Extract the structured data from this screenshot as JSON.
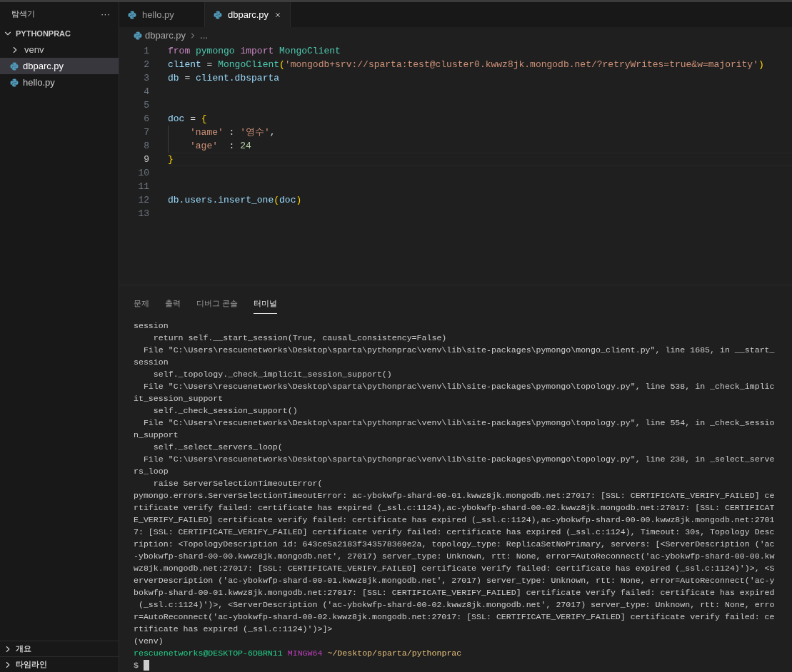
{
  "explorer": {
    "title": "탐색기",
    "more": "···",
    "root": {
      "label": "PYTHONPRAC",
      "expanded": true,
      "children": [
        {
          "label": "venv",
          "kind": "folder",
          "expanded": false,
          "selected": false
        },
        {
          "label": "dbparc.py",
          "kind": "file",
          "selected": true
        },
        {
          "label": "hello.py",
          "kind": "file",
          "selected": false
        }
      ]
    },
    "sections": [
      {
        "label": "개요",
        "expanded": false
      },
      {
        "label": "타임라인",
        "expanded": false
      }
    ]
  },
  "tabs": [
    {
      "label": "hello.py",
      "selected": false
    },
    {
      "label": "dbparc.py",
      "selected": true
    }
  ],
  "breadcrumb": {
    "file": "dbparc.py",
    "rest": "..."
  },
  "editor": {
    "lines": [
      {
        "number": "1",
        "current": false,
        "indented": false,
        "tokens": [
          {
            "text": "from ",
            "kind": "keyword"
          },
          {
            "text": "pymongo ",
            "kind": "module"
          },
          {
            "text": "import ",
            "kind": "keyword"
          },
          {
            "text": "MongoClient",
            "kind": "class"
          }
        ]
      },
      {
        "number": "2",
        "current": false,
        "indented": false,
        "tokens": [
          {
            "text": "client",
            "kind": "variable"
          },
          {
            "text": " = ",
            "kind": "plain"
          },
          {
            "text": "MongoClient",
            "kind": "class"
          },
          {
            "text": "(",
            "kind": "bracket"
          },
          {
            "text": "'mongodb+srv://sparta:test@cluster0.kwwz8jk.mongodb.net/?retryWrites=true&w=majority'",
            "kind": "string"
          },
          {
            "text": ")",
            "kind": "bracket"
          }
        ]
      },
      {
        "number": "3",
        "current": false,
        "indented": false,
        "tokens": [
          {
            "text": "db",
            "kind": "variable"
          },
          {
            "text": " = ",
            "kind": "plain"
          },
          {
            "text": "client.dbsparta",
            "kind": "variable"
          }
        ]
      },
      {
        "number": "4",
        "current": false,
        "indented": false
      },
      {
        "number": "5",
        "current": false,
        "indented": false
      },
      {
        "number": "6",
        "current": false,
        "indented": false,
        "tokens": [
          {
            "text": "doc",
            "kind": "variable"
          },
          {
            "text": " = ",
            "kind": "plain"
          },
          {
            "text": "{",
            "kind": "bracket"
          }
        ]
      },
      {
        "number": "7",
        "current": false,
        "indented": true,
        "tokens": [
          {
            "text": "'name'",
            "kind": "string"
          },
          {
            "text": " : ",
            "kind": "plain"
          },
          {
            "text": "'영수'",
            "kind": "string"
          },
          {
            "text": ",",
            "kind": "plain"
          }
        ]
      },
      {
        "number": "8",
        "current": false,
        "indented": true,
        "tokens": [
          {
            "text": "'age'",
            "kind": "string"
          },
          {
            "text": "  : ",
            "kind": "plain"
          },
          {
            "text": "24",
            "kind": "number"
          }
        ]
      },
      {
        "number": "9",
        "current": true,
        "indented": false,
        "tokens": [
          {
            "text": "}",
            "kind": "bracket"
          }
        ]
      },
      {
        "number": "10",
        "current": false,
        "indented": false
      },
      {
        "number": "11",
        "current": false,
        "indented": false
      },
      {
        "number": "12",
        "current": false,
        "indented": false,
        "tokens": [
          {
            "text": "db.users.insert_one",
            "kind": "variable"
          },
          {
            "text": "(",
            "kind": "bracket"
          },
          {
            "text": "doc",
            "kind": "variable"
          },
          {
            "text": ")",
            "kind": "bracket"
          }
        ]
      },
      {
        "number": "13",
        "current": false,
        "indented": false
      }
    ]
  },
  "panel": {
    "tabs": [
      {
        "label": "문제",
        "selected": false
      },
      {
        "label": "출력",
        "selected": false
      },
      {
        "label": "디버그 콘솔",
        "selected": false
      },
      {
        "label": "터미널",
        "selected": true
      }
    ],
    "terminal": [
      {
        "kind": "output",
        "text": "session"
      },
      {
        "kind": "output",
        "text": "    return self.__start_session(True, causal_consistency=False)"
      },
      {
        "kind": "output",
        "text": "  File \"C:\\Users\\rescuenetworks\\Desktop\\sparta\\pythonprac\\venv\\lib\\site-packages\\pymongo\\mongo_client.py\", line 1685, in __start_"
      },
      {
        "kind": "output",
        "text": "session"
      },
      {
        "kind": "output",
        "text": "    self._topology._check_implicit_session_support()"
      },
      {
        "kind": "output",
        "text": "  File \"C:\\Users\\rescuenetworks\\Desktop\\sparta\\pythonprac\\venv\\lib\\site-packages\\pymongo\\topology.py\", line 538, in _check_implic"
      },
      {
        "kind": "output",
        "text": "it_session_support"
      },
      {
        "kind": "output",
        "text": "    self._check_session_support()"
      },
      {
        "kind": "output",
        "text": "  File \"C:\\Users\\rescuenetworks\\Desktop\\sparta\\pythonprac\\venv\\lib\\site-packages\\pymongo\\topology.py\", line 554, in _check_sessio"
      },
      {
        "kind": "output",
        "text": "n_support"
      },
      {
        "kind": "output",
        "text": "    self._select_servers_loop("
      },
      {
        "kind": "output",
        "text": "  File \"C:\\Users\\rescuenetworks\\Desktop\\sparta\\pythonprac\\venv\\lib\\site-packages\\pymongo\\topology.py\", line 238, in _select_serve"
      },
      {
        "kind": "output",
        "text": "rs_loop"
      },
      {
        "kind": "output",
        "text": "    raise ServerSelectionTimeoutError("
      },
      {
        "kind": "output",
        "text": "pymongo.errors.ServerSelectionTimeoutError: ac-ybokwfp-shard-00-01.kwwz8jk.mongodb.net:27017: [SSL: CERTIFICATE_VERIFY_FAILED] ce"
      },
      {
        "kind": "output",
        "text": "rtificate verify failed: certificate has expired (_ssl.c:1124),ac-ybokwfp-shard-00-02.kwwz8jk.mongodb.net:27017: [SSL: CERTIFICAT"
      },
      {
        "kind": "output",
        "text": "E_VERIFY_FAILED] certificate verify failed: certificate has expired (_ssl.c:1124),ac-ybokwfp-shard-00-00.kwwz8jk.mongodb.net:2701"
      },
      {
        "kind": "output",
        "text": "7: [SSL: CERTIFICATE_VERIFY_FAILED] certificate verify failed: certificate has expired (_ssl.c:1124), Timeout: 30s, Topology Desc"
      },
      {
        "kind": "output",
        "text": "ription: <TopologyDescription id: 643ce5a2183f343578369e2a, topology_type: ReplicaSetNoPrimary, servers: [<ServerDescription ('ac"
      },
      {
        "kind": "output",
        "text": "-ybokwfp-shard-00-00.kwwz8jk.mongodb.net', 27017) server_type: Unknown, rtt: None, error=AutoReconnect('ac-ybokwfp-shard-00-00.kw"
      },
      {
        "kind": "output",
        "text": "wz8jk.mongodb.net:27017: [SSL: CERTIFICATE_VERIFY_FAILED] certificate verify failed: certificate has expired (_ssl.c:1124)')>, <S"
      },
      {
        "kind": "output",
        "text": "erverDescription ('ac-ybokwfp-shard-00-01.kwwz8jk.mongodb.net', 27017) server_type: Unknown, rtt: None, error=AutoReconnect('ac-y"
      },
      {
        "kind": "output",
        "text": "bokwfp-shard-00-01.kwwz8jk.mongodb.net:27017: [SSL: CERTIFICATE_VERIFY_FAILED] certificate verify failed: certificate has expired"
      },
      {
        "kind": "output",
        "text": " (_ssl.c:1124)')>, <ServerDescription ('ac-ybokwfp-shard-00-02.kwwz8jk.mongodb.net', 27017) server_type: Unknown, rtt: None, erro"
      },
      {
        "kind": "output",
        "text": "r=AutoReconnect('ac-ybokwfp-shard-00-02.kwwz8jk.mongodb.net:27017: [SSL: CERTIFICATE_VERIFY_FAILED] certificate verify failed: ce"
      },
      {
        "kind": "output",
        "text": "rtificate has expired (_ssl.c:1124)')>]>"
      },
      {
        "kind": "output",
        "text": "(venv)"
      },
      {
        "kind": "prompt",
        "user": "rescuenetworks@DESKTOP-6DBRN11",
        "host": "MINGW64",
        "path": "~/Desktop/sparta/pythonprac"
      },
      {
        "kind": "input",
        "symbol": "$"
      }
    ]
  }
}
